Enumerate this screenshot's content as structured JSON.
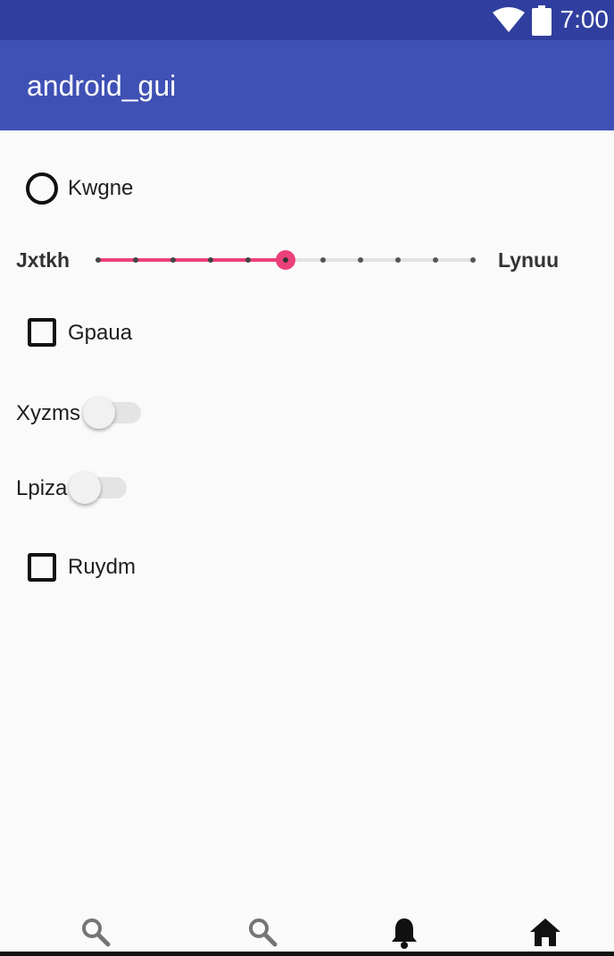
{
  "status_bar": {
    "time": "7:00",
    "wifi_icon": "wifi-icon",
    "battery_icon": "battery-icon"
  },
  "app_bar": {
    "title": "android_gui"
  },
  "radio": {
    "label": "Kwgne",
    "checked": false
  },
  "seekbar": {
    "left_label": "Jxtkh",
    "right_label": "Lynuu",
    "value": 5,
    "max": 10,
    "accent": "#ec407a"
  },
  "checkbox1": {
    "label": "Gpaua",
    "checked": false
  },
  "switch1": {
    "label": "Xyzms",
    "on": false
  },
  "switch2": {
    "label": "Lpiza",
    "on": false
  },
  "checkbox2": {
    "label": "Ruydm",
    "checked": false
  },
  "bottom_nav": {
    "items": [
      {
        "icon": "search-icon"
      },
      {
        "icon": "search-icon"
      },
      {
        "icon": "bell-icon"
      },
      {
        "icon": "home-icon"
      }
    ]
  },
  "colors": {
    "status_bar": "#303f9f",
    "app_bar": "#3f51b5",
    "background": "#fafafa"
  }
}
